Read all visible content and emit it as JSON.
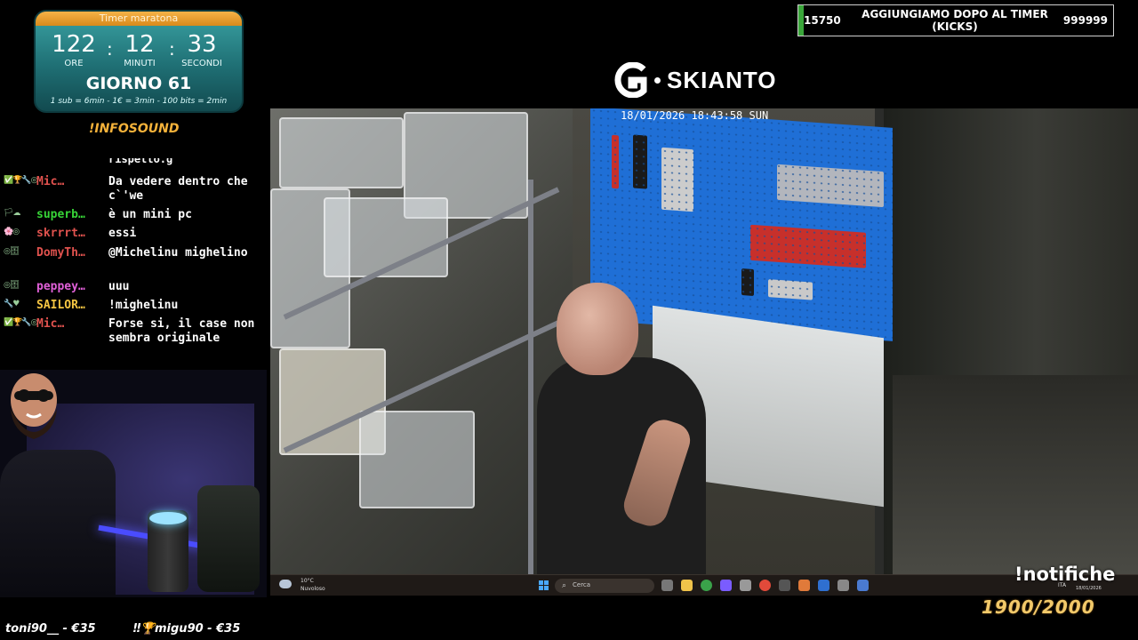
{
  "timer": {
    "title": "Timer maratona",
    "hours": "122",
    "minutes": "12",
    "seconds": "33",
    "hours_label": "ORE",
    "minutes_label": "MINUTI",
    "seconds_label": "SECONDI",
    "day": "GIORNO 61",
    "rates": "1 sub = 6min - 1€ = 3min - 100 bits = 2min"
  },
  "infosound": "!INFOSOUND",
  "chat": {
    "cut_off_text": "rispetto.g",
    "messages": [
      {
        "badges": "✅🏆🔧◎",
        "user": "Mic…",
        "user_color": "#e0524e",
        "text": "Da vedere dentro che c`'we"
      },
      {
        "badges": "🏳☁",
        "user": "superb…",
        "user_color": "#37d437",
        "text": "è un mini pc"
      },
      {
        "badges": "🌸◎",
        "user": "skrrrt…",
        "user_color": "#e0524e",
        "text": "essi"
      },
      {
        "badges": "◎🗄",
        "user": "DomyTh…",
        "user_color": "#e0524e",
        "text": "@Michelinu mighelino"
      },
      {
        "badges": "◎🗄",
        "user": "peppey…",
        "user_color": "#e060d8",
        "text": "uuu"
      },
      {
        "badges": "🔧♥",
        "user": "SAILOR…",
        "user_color": "#f5c542",
        "text": "!mighelinu"
      },
      {
        "badges": "✅🏆🔧◎",
        "user": "Mic…",
        "user_color": "#e0524e",
        "text": "Forse si, il case non sembra originale"
      }
    ]
  },
  "tips": {
    "tip1": "toni90__ - €35",
    "tip2_icons": "‼🏆",
    "tip2": "migu90 - €35"
  },
  "goal": {
    "current": "15750",
    "label": "AGGIUNGIAMO DOPO AL TIMER (KICKS)",
    "target": "999999",
    "progress_fraction": 0.016
  },
  "logo": {
    "text": "SKIANTO"
  },
  "cam": {
    "timestamp": "18/01/2026  18:43:58 SUN"
  },
  "taskbar": {
    "weather_temp": "10°C",
    "weather_cond": "Nuvoloso",
    "search_label": "Cerca",
    "lang": "ITA",
    "date": "18/01/2026"
  },
  "overlay": {
    "notifiche": "!notifiche",
    "sub_goal": "1900/2000"
  },
  "colors": {
    "timer_teal": "#2a8a8e",
    "timer_orange": "#f5a623",
    "gold": "#f2c96a",
    "pegboard_blue": "#1f6fd6"
  }
}
